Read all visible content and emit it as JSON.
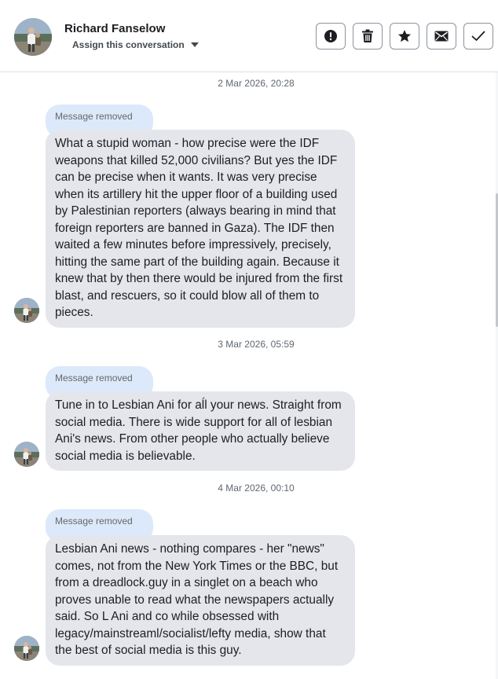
{
  "header": {
    "name": "Richard Fanselow",
    "assign_label": "Assign this conversation",
    "toolbar": [
      {
        "icon": "exclamation-circle-icon",
        "label": "Mark as spam"
      },
      {
        "icon": "trash-icon",
        "label": "Delete"
      },
      {
        "icon": "star-icon",
        "label": "Star"
      },
      {
        "icon": "envelope-icon",
        "label": "Mark as unread"
      },
      {
        "icon": "checkmark-icon",
        "label": "Mark as done"
      }
    ]
  },
  "conversation": [
    {
      "timestamp": "2 Mar 2026, 20:28",
      "removed_label": "Message removed",
      "text": "What a stupid woman - how precise were the IDF weapons that killed 52,000 civilians? But yes the IDF can be precise when it wants. It was very precise when its artillery hit the upper floor of a building used by Palestinian reporters (always bearing in mind that foreign reporters are banned in Gaza). The IDF then waited a few minutes before impressively, precisely, hitting the same part of the building again. Because it knew that by then there would be injured from the first blast, and rescuers, so it could blow all of them to pieces."
    },
    {
      "timestamp": "3 Mar 2026, 05:59",
      "removed_label": "Message removed",
      "text": "Tune in to Lesbian Ani for aĺl your news. Straight from social media. There is wide support for all of lesbian Ani's news. From other people who actually believe social media is believable."
    },
    {
      "timestamp": "4 Mar 2026, 00:10",
      "removed_label": "Message removed",
      "text": "Lesbian Ani news - nothing compares - her \"news\" comes, not from the New York Times or the BBC, but from a dreadlock.guy in a singlet on a beach who proves unable to read what the newspapers actually said. So L Ani and co while obsessed with legacy/mainstreaml/socialist/lefty media,  show that the best of social media is this guy."
    }
  ],
  "colors": {
    "bubble": "#e4e6eb",
    "removed_pill": "#dce9fa",
    "text": "#1c1e21",
    "muted": "#606770",
    "border": "#8d949e"
  }
}
